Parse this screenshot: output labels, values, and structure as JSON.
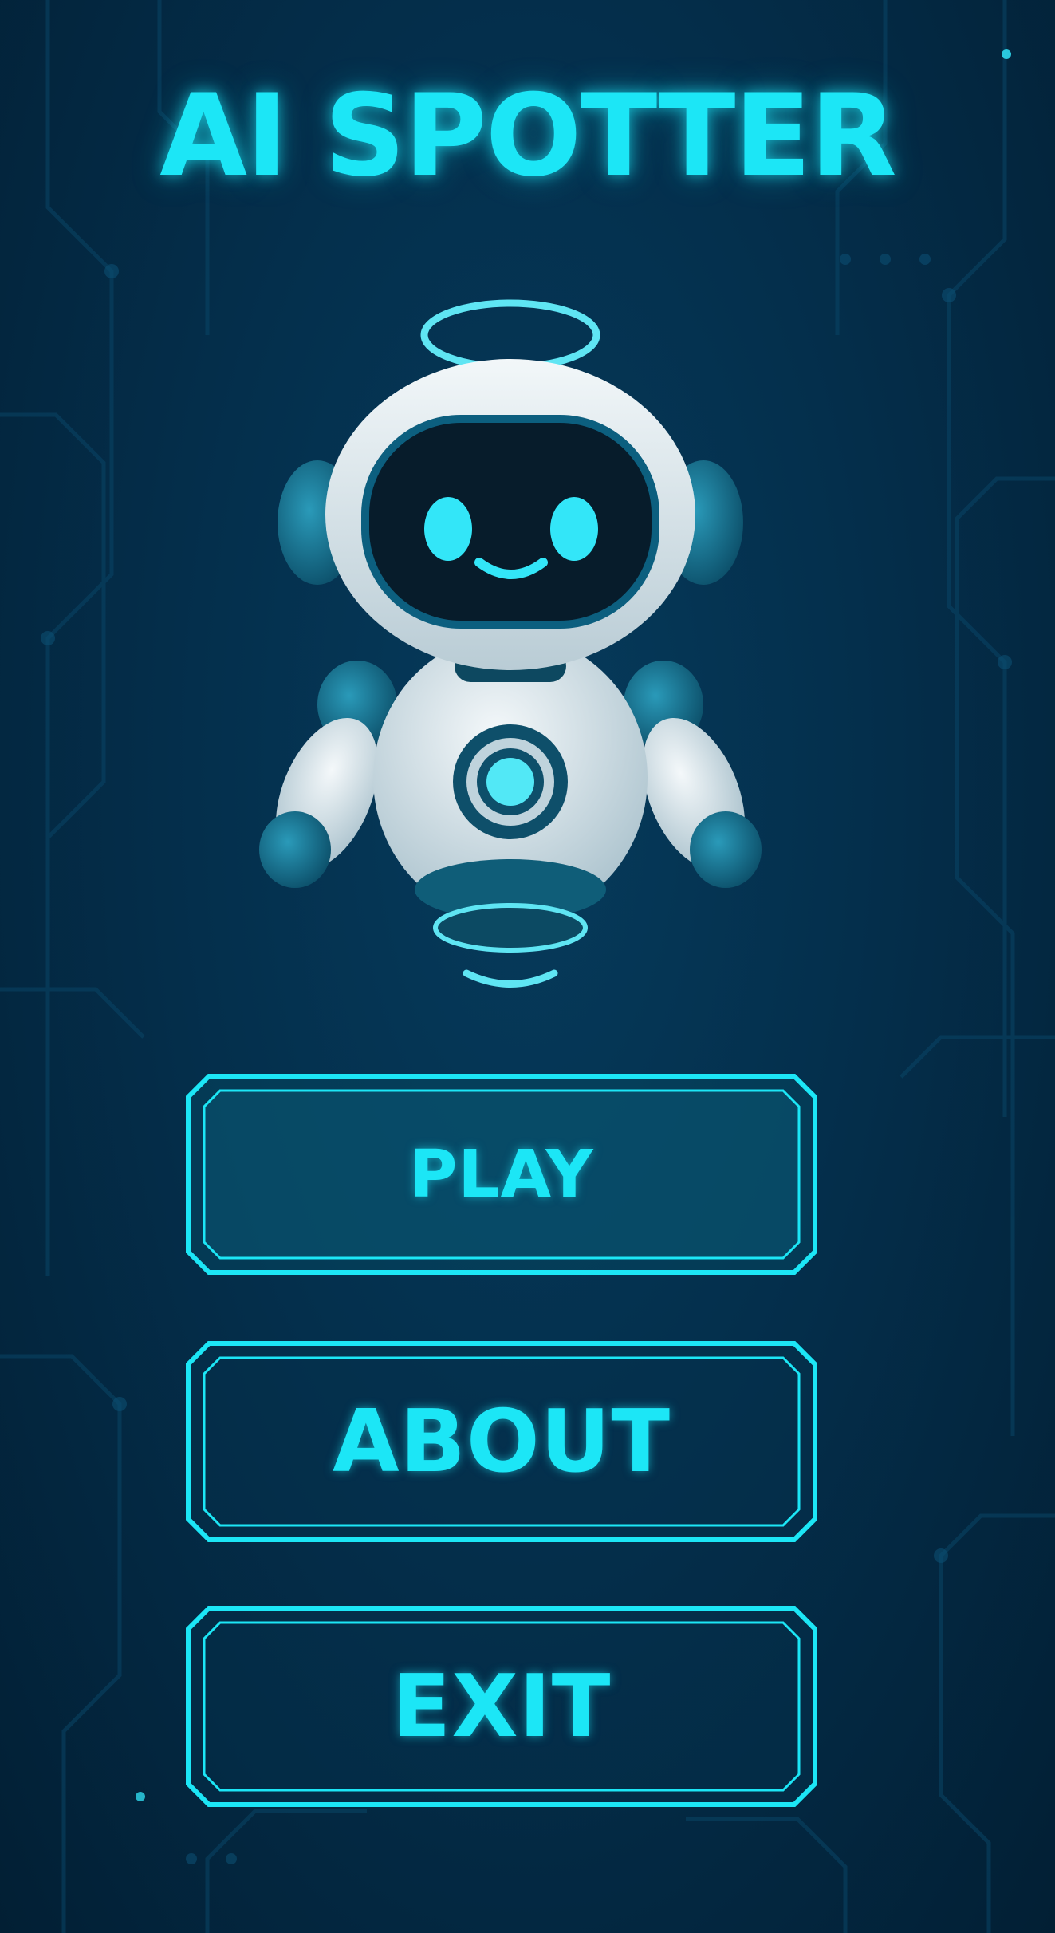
{
  "app": {
    "title": "AI SPOTTER"
  },
  "colors": {
    "background": "#032a44",
    "accent": "#1ce6f6",
    "robot_body": "#e6eef2",
    "robot_dark": "#0d5f7c"
  },
  "icons": {
    "mascot": "robot-mascot-icon",
    "halo": "halo-icon"
  },
  "menu": {
    "play_label": "PLAY",
    "about_label": "ABOUT",
    "exit_label": "EXIT"
  }
}
